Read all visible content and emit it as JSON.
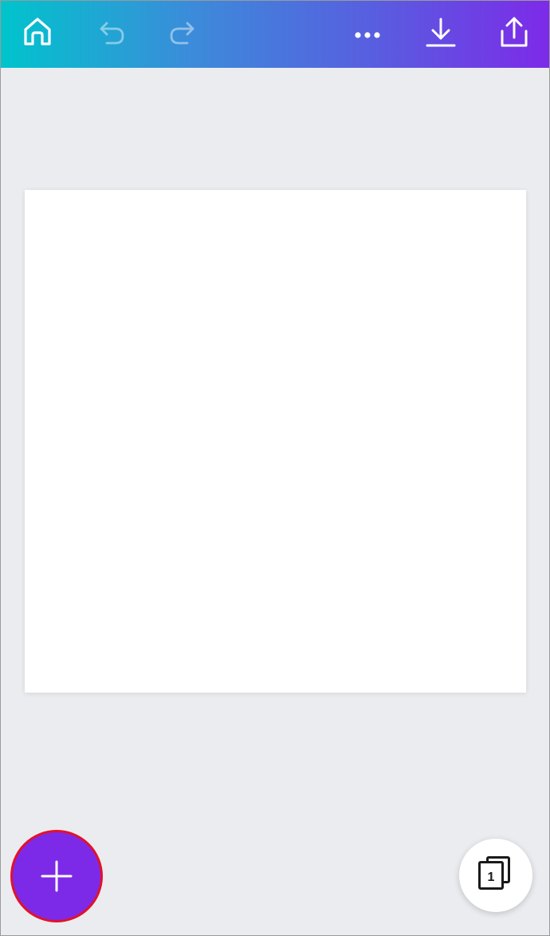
{
  "toolbar": {
    "gradient_start": "#00C4CC",
    "gradient_end": "#7D2AE8",
    "buttons": [
      {
        "icon": "home-icon",
        "enabled": true
      },
      {
        "icon": "undo-icon",
        "enabled": false
      },
      {
        "icon": "redo-icon",
        "enabled": false
      },
      {
        "icon": "more-icon",
        "enabled": true
      },
      {
        "icon": "download-icon",
        "enabled": true
      },
      {
        "icon": "share-icon",
        "enabled": true
      }
    ]
  },
  "canvas": {
    "background": "#FFFFFF"
  },
  "workspace": {
    "background": "#EBECF0"
  },
  "fab": {
    "icon": "plus-icon",
    "color": "#7D2AE8",
    "highlight_color": "#E0122B"
  },
  "pages": {
    "icon": "pages-icon",
    "count": "1"
  }
}
